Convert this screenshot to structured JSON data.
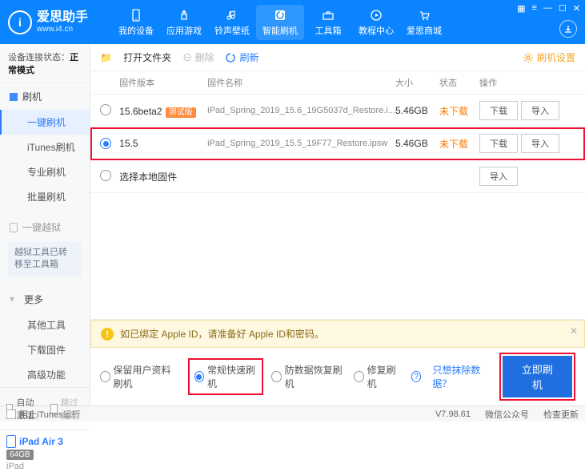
{
  "brand": {
    "name": "爱思助手",
    "url": "www.i4.cn",
    "logo_letter": "ἰ"
  },
  "topnav": [
    {
      "label": "我的设备"
    },
    {
      "label": "应用游戏"
    },
    {
      "label": "铃声壁纸"
    },
    {
      "label": "智能刷机"
    },
    {
      "label": "工具箱"
    },
    {
      "label": "教程中心"
    },
    {
      "label": "爱思商城"
    }
  ],
  "sidebar": {
    "conn_label": "设备连接状态：",
    "conn_value": "正常模式",
    "group_flash": "刷机",
    "items_flash": [
      "一键刷机",
      "iTunes刷机",
      "专业刷机",
      "批量刷机"
    ],
    "group_jailbreak": "一键越狱",
    "jailbreak_note": "越狱工具已转移至工具箱",
    "group_more": "更多",
    "items_more": [
      "其他工具",
      "下载固件",
      "高级功能"
    ],
    "auto_activate": "自动激活",
    "skip_guide": "跳过向导",
    "block_itunes": "阻止iTunes运行"
  },
  "device": {
    "name": "iPad Air 3",
    "storage": "64GB",
    "type": "iPad"
  },
  "toolbar": {
    "open_folder": "打开文件夹",
    "delete": "删除",
    "refresh": "刷新",
    "settings": "刷机设置"
  },
  "table": {
    "h_version": "固件版本",
    "h_name": "固件名称",
    "h_size": "大小",
    "h_status": "状态",
    "h_ops": "操作",
    "rows": [
      {
        "version": "15.6beta2",
        "beta": "测试版",
        "name": "iPad_Spring_2019_15.6_19G5037d_Restore.i...",
        "size": "5.46GB",
        "status": "未下载",
        "selected": false
      },
      {
        "version": "15.5",
        "beta": "",
        "name": "iPad_Spring_2019_15.5_19F77_Restore.ipsw",
        "size": "5.46GB",
        "status": "未下载",
        "selected": true
      }
    ],
    "local_fw": "选择本地固件",
    "btn_download": "下载",
    "btn_import": "导入"
  },
  "warning": "如已绑定 Apple ID，请准备好 Apple ID和密码。",
  "options": {
    "o1": "保留用户资料刷机",
    "o2": "常规快速刷机",
    "o3": "防数据恢复刷机",
    "o4": "修复刷机",
    "link": "只想抹除数据？",
    "primary": "立即刷机"
  },
  "status": {
    "version": "V7.98.61",
    "wechat": "微信公众号",
    "update": "检查更新"
  }
}
